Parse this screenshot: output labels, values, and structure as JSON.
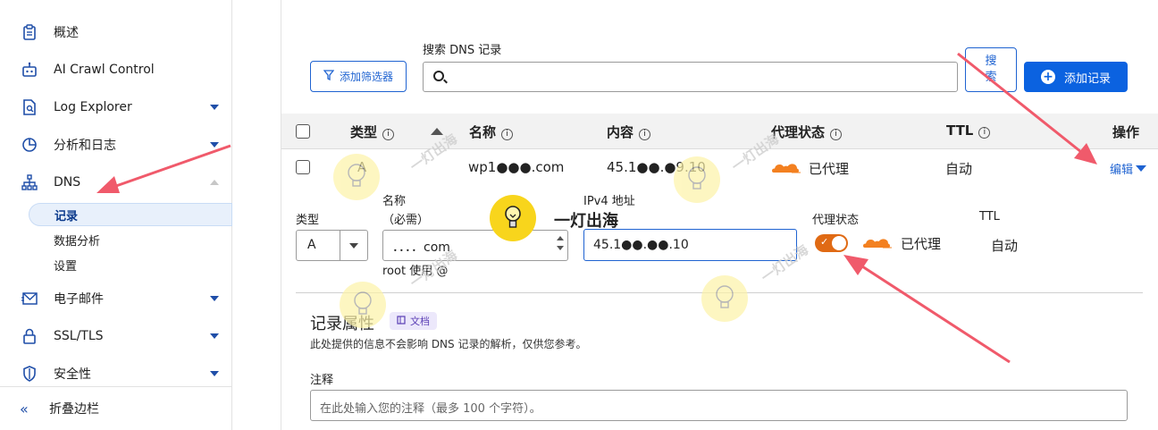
{
  "sidebar": {
    "items": [
      {
        "label": "概述",
        "icon": "clipboard-icon",
        "caret": ""
      },
      {
        "label": "AI Crawl Control",
        "icon": "robot-icon",
        "caret": ""
      },
      {
        "label": "Log Explorer",
        "icon": "document-search-icon",
        "caret": "down"
      },
      {
        "label": "分析和日志",
        "icon": "pie-chart-icon",
        "caret": "down"
      },
      {
        "label": "DNS",
        "icon": "network-icon",
        "caret": "up"
      },
      {
        "label": "电子邮件",
        "icon": "email-icon",
        "caret": "down"
      },
      {
        "label": "SSL/TLS",
        "icon": "lock-icon",
        "caret": "down"
      },
      {
        "label": "安全性",
        "icon": "shield-icon",
        "caret": "down"
      }
    ],
    "dns_subitems": [
      {
        "label": "记录",
        "active": true
      },
      {
        "label": "数据分析",
        "active": false
      },
      {
        "label": "设置",
        "active": false
      }
    ],
    "collapse_label": "折叠边栏"
  },
  "toolbar": {
    "search_label": "搜索 DNS 记录",
    "filter_button": "添加筛选器",
    "search_button": "搜索",
    "add_record_button": "添加记录"
  },
  "table": {
    "headers": {
      "type": "类型",
      "name": "名称",
      "content": "内容",
      "proxy": "代理状态",
      "ttl": "TTL",
      "actions": "操作"
    },
    "row": {
      "type": "A",
      "name": "wp1●●●.com",
      "content": "45.1●●.●9.10",
      "proxy": "已代理",
      "ttl": "自动",
      "edit": "编辑"
    }
  },
  "edit_form": {
    "type_label": "类型",
    "type_value": "A",
    "name_label": "名称",
    "name_required": "（必需）",
    "name_value": "．．．．com",
    "name_hint": "root 使用 @",
    "ipv4_label": "IPv4 地址",
    "ipv4_value": "45.1●●.●●.10",
    "proxy_label": "代理状态",
    "proxy_value": "已代理",
    "proxy_enabled": true,
    "ttl_label": "TTL",
    "ttl_value": "自动"
  },
  "properties": {
    "title": "记录属性",
    "doc_badge": "文档",
    "description": "此处提供的信息不会影响 DNS 记录的解析，仅供您参考。",
    "note_label": "注释",
    "note_placeholder": "在此处输入您的注释（最多 100 个字符）。"
  },
  "watermark": {
    "text": "一灯出海"
  },
  "colors": {
    "accent": "#0b62e0",
    "link": "#1f63d1",
    "proxy_orange": "#f38020",
    "toggle_on": "#e06a14",
    "annotation_arrow": "#f05a6b"
  }
}
